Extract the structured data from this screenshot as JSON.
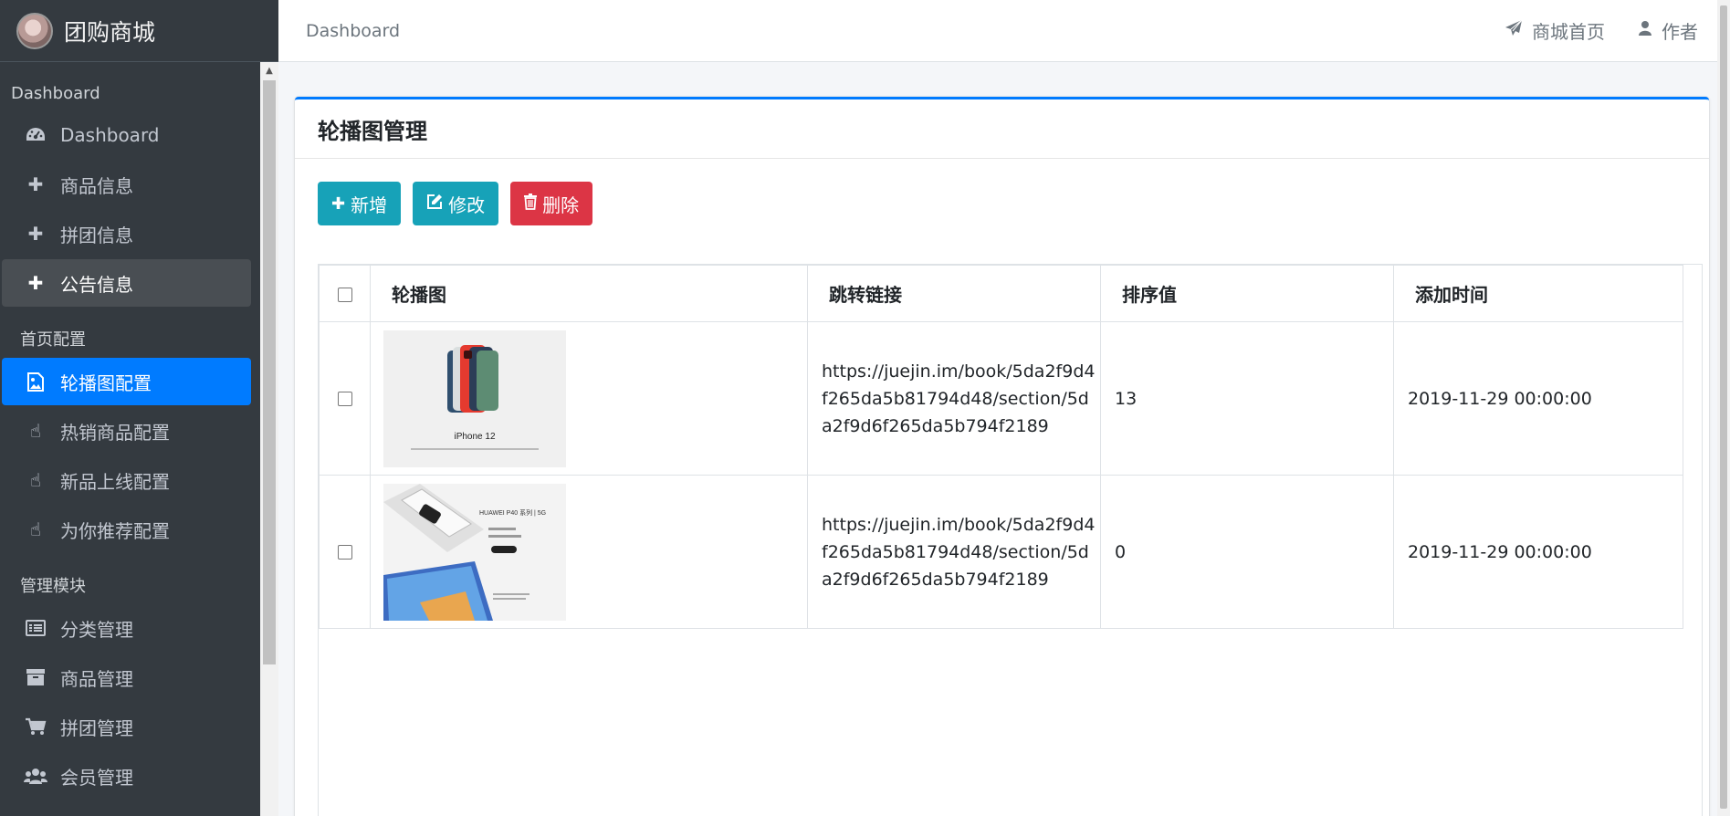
{
  "brand": {
    "title": "团购商城"
  },
  "sidebar": {
    "header_dashboard": "Dashboard",
    "dashboard_items": [
      {
        "label": "Dashboard",
        "icon": "dashboard-icon"
      },
      {
        "label": "商品信息",
        "icon": "plus-icon"
      },
      {
        "label": "拼团信息",
        "icon": "plus-icon"
      },
      {
        "label": "公告信息",
        "icon": "plus-icon"
      }
    ],
    "header_home": "首页配置",
    "home_items": [
      {
        "label": "轮播图配置",
        "icon": "image-icon"
      },
      {
        "label": "热销商品配置",
        "icon": "hand-pointer-icon"
      },
      {
        "label": "新品上线配置",
        "icon": "hand-pointer-icon"
      },
      {
        "label": "为你推荐配置",
        "icon": "hand-pointer-icon"
      }
    ],
    "header_manage": "管理模块",
    "manage_items": [
      {
        "label": "分类管理",
        "icon": "list-icon"
      },
      {
        "label": "商品管理",
        "icon": "archive-icon"
      },
      {
        "label": "拼团管理",
        "icon": "cart-icon"
      },
      {
        "label": "会员管理",
        "icon": "users-icon"
      }
    ],
    "active_item": "轮播图配置",
    "accent_color": "#007bff"
  },
  "topbar": {
    "breadcrumb": "Dashboard",
    "mall_home_label": "商城首页",
    "author_label": "作者"
  },
  "card": {
    "title": "轮播图管理",
    "buttons": {
      "add": "新增",
      "edit": "修改",
      "delete": "删除"
    }
  },
  "table": {
    "headers": [
      "轮播图",
      "跳转链接",
      "排序值",
      "添加时间"
    ],
    "rows": [
      {
        "image": "iPhone 12 carousel image",
        "image_caption": "iPhone 12",
        "link": "https://juejin.im/book/5da2f9d4f265da5b81794d48/section/5da2f9d6f265da5b794f2189",
        "order": "13",
        "added": "2019-11-29 00:00:00"
      },
      {
        "image": "Huawei P40 carousel image",
        "image_caption": "HUAWEI P40 系列 | 5G",
        "link": "https://juejin.im/book/5da2f9d4f265da5b81794d48/section/5da2f9d6f265da5b794f2189",
        "order": "0",
        "added": "2019-11-29 00:00:00"
      }
    ]
  },
  "colors": {
    "info": "#17a2b8",
    "danger": "#dc3545",
    "sidebar_bg": "#343a40"
  }
}
